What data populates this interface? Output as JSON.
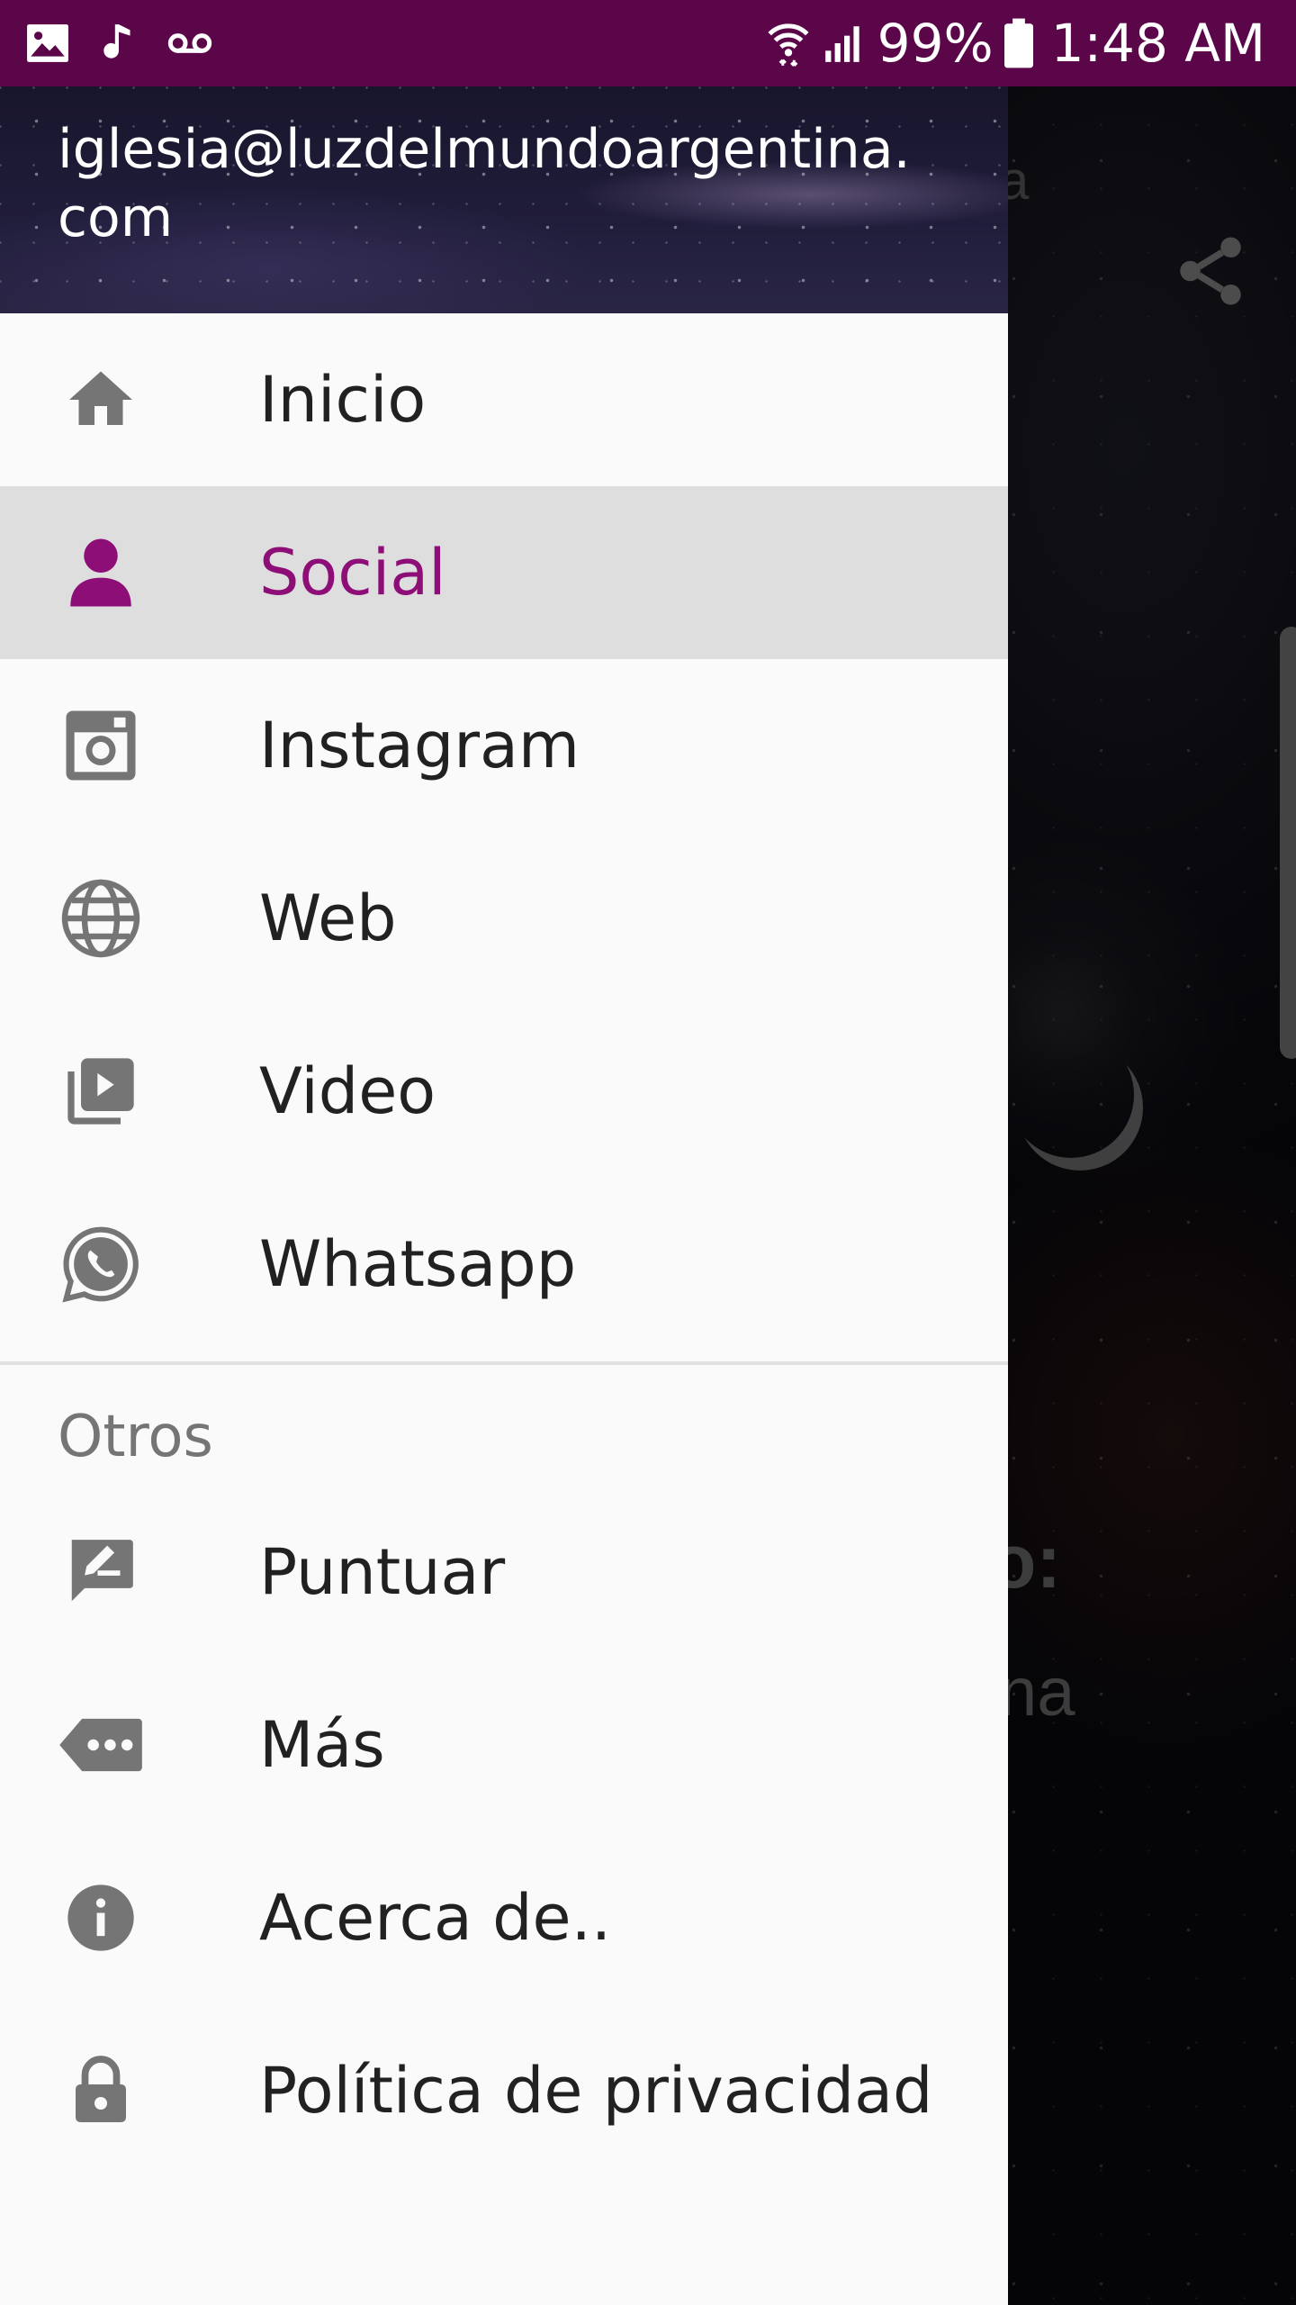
{
  "status_bar": {
    "battery": "99%",
    "time": "1:48 AM",
    "icons": [
      "image-icon",
      "music-note-icon",
      "voicemail-icon",
      "wifi-icon",
      "signal-icon",
      "battery-icon"
    ]
  },
  "background_screen": {
    "partial_title": "a",
    "partial_heading": "o:",
    "partial_subtext": "na"
  },
  "drawer": {
    "header_email": "iglesia@luzdelmundoargentina.com",
    "items": [
      {
        "label": "Inicio",
        "icon": "home-icon",
        "active": false
      },
      {
        "label": "Social",
        "icon": "person-icon",
        "active": true
      },
      {
        "label": "Instagram",
        "icon": "instagram-icon",
        "active": false
      },
      {
        "label": "Web",
        "icon": "globe-icon",
        "active": false
      },
      {
        "label": "Video",
        "icon": "video-library-icon",
        "active": false
      },
      {
        "label": "Whatsapp",
        "icon": "whatsapp-icon",
        "active": false
      }
    ],
    "section_title": "Otros",
    "other_items": [
      {
        "label": "Puntuar",
        "icon": "rate-review-icon"
      },
      {
        "label": "Más",
        "icon": "more-icon"
      },
      {
        "label": "Acerca de..",
        "icon": "info-icon"
      },
      {
        "label": "Política de privacidad",
        "icon": "lock-icon"
      }
    ]
  },
  "colors": {
    "status_bar": "#5b0648",
    "accent": "#8e0e78",
    "icon_gray": "#757575",
    "active_bg": "#dedede"
  }
}
